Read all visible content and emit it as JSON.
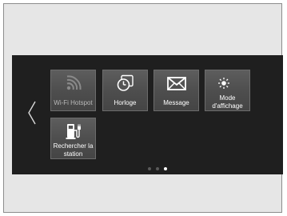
{
  "tiles": {
    "wifi": {
      "label": "Wi-Fi Hotspot",
      "icon": "wifi-icon",
      "enabled": false
    },
    "clock": {
      "label": "Horloge",
      "icon": "clock-icon",
      "enabled": true
    },
    "message": {
      "label": "Message",
      "icon": "envelope-icon",
      "enabled": true
    },
    "display": {
      "label_line1": "Mode",
      "label_line2": "d'affichage",
      "icon": "sun-moon-icon",
      "enabled": true
    },
    "station": {
      "label_line1": "Rechercher la",
      "label_line2": "station",
      "icon": "charging-station-icon",
      "enabled": true
    }
  },
  "navigation": {
    "back_icon": "chevron-left-icon"
  },
  "pager": {
    "pages": 3,
    "current": 3
  },
  "colors": {
    "screen_bg": "#1f1f1f",
    "tile_bg": "#555555",
    "page_bg": "#e6e6e6"
  }
}
